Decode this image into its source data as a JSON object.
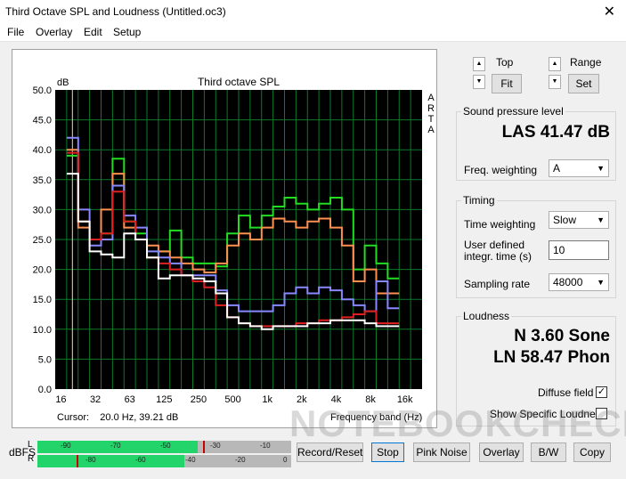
{
  "window": {
    "title": "Third Octave SPL and Loudness (Untitled.oc3)",
    "close_glyph": "✕"
  },
  "menu": [
    "File",
    "Overlay",
    "Edit",
    "Setup"
  ],
  "plot": {
    "title": "Third octave SPL",
    "ylabel": "dB",
    "side_text": [
      "A",
      "R",
      "T",
      "A"
    ],
    "cursor_text": "Cursor:    20.0 Hz, 39.21 dB",
    "xlabel": "Frequency band (Hz)"
  },
  "chart_data": {
    "type": "line",
    "title": "Third octave SPL",
    "ylabel": "dB",
    "xlabel": "Frequency band (Hz)",
    "ylim": [
      0,
      50
    ],
    "yticks": [
      "0.0",
      "5.0",
      "10.0",
      "15.0",
      "20.0",
      "25.0",
      "30.0",
      "35.0",
      "40.0",
      "45.0",
      "50.0"
    ],
    "xticks": [
      "16",
      "32",
      "63",
      "125",
      "250",
      "500",
      "1k",
      "2k",
      "4k",
      "8k",
      "16k"
    ],
    "bands": [
      "16",
      "20",
      "25",
      "31.5",
      "40",
      "50",
      "63",
      "80",
      "100",
      "125",
      "160",
      "200",
      "250",
      "315",
      "400",
      "500",
      "630",
      "800",
      "1k",
      "1.25k",
      "1.6k",
      "2k",
      "2.5k",
      "3.15k",
      "4k",
      "5k",
      "6.3k",
      "8k",
      "10k",
      "12.5k",
      "16k",
      "20k"
    ],
    "grid": true,
    "series": [
      {
        "color": "#22dd22",
        "values": [
          39,
          28,
          25,
          26,
          38.5,
          28,
          26,
          22,
          23,
          26.5,
          22,
          21,
          21,
          20.5,
          26,
          29,
          27,
          29,
          30.5,
          32,
          31,
          30,
          31,
          32,
          30,
          20,
          24,
          21,
          18.5
        ]
      },
      {
        "color": "#ff9050",
        "values": [
          40,
          27,
          25,
          30,
          36,
          27,
          25,
          24,
          23,
          22,
          21,
          20,
          19.5,
          21,
          24,
          26,
          25,
          27,
          28.5,
          28,
          27,
          28,
          28.5,
          27,
          24,
          18,
          20,
          16,
          16
        ]
      },
      {
        "color": "#8888ff",
        "values": [
          42,
          30,
          24,
          25,
          34,
          29,
          27,
          23,
          22,
          21,
          19,
          19,
          19,
          16.5,
          14,
          13,
          13,
          13,
          14,
          16,
          17,
          16,
          17,
          16.5,
          15,
          14,
          13,
          18,
          13.5
        ]
      },
      {
        "color": "#e02020",
        "values": [
          39.5,
          28,
          25,
          26,
          33,
          28,
          25,
          22,
          21,
          20,
          19,
          18,
          17,
          14,
          12,
          11,
          10.5,
          10.5,
          10.5,
          10.5,
          11,
          11,
          11.5,
          11.5,
          12,
          12.5,
          13,
          11,
          11
        ]
      },
      {
        "color": "#ffffff",
        "values": [
          36,
          28,
          23,
          22.5,
          22,
          26,
          25,
          22,
          18.5,
          19,
          19,
          18.5,
          18,
          16,
          12,
          11,
          10.5,
          10,
          10.5,
          10.5,
          10.5,
          11,
          11,
          11.5,
          11.5,
          11.5,
          11,
          10.5,
          10.5
        ]
      }
    ]
  },
  "controls": {
    "top_label": "Top",
    "fit_button": "Fit",
    "range_label": "Range",
    "set_button": "Set",
    "spin_up": "▲",
    "spin_down": "▼"
  },
  "spl": {
    "group_title": "Sound pressure level",
    "value": "LAS 41.47 dB",
    "freq_weighting_label": "Freq. weighting",
    "freq_weighting_value": "A"
  },
  "timing": {
    "group_title": "Timing",
    "time_weighting_label": "Time weighting",
    "time_weighting_value": "Slow",
    "integr_label_1": "User defined",
    "integr_label_2": "integr. time (s)",
    "integr_value": "10",
    "sampling_label": "Sampling rate",
    "sampling_value": "48000"
  },
  "loudness": {
    "group_title": "Loudness",
    "sone": "N 3.60 Sone",
    "phon": "LN 58.47 Phon",
    "diffuse_label": "Diffuse field",
    "diffuse_checked": "✓",
    "specific_label": "Show Specific Loudness"
  },
  "meter": {
    "dbfs_label": "dBFS",
    "left_channel": "L",
    "right_channel": "R",
    "left_ticks": [
      "-90",
      "-70",
      "-50",
      "-30",
      "-10"
    ],
    "right_ticks": [
      "-80",
      "-60",
      "-40",
      "-20",
      "0"
    ],
    "left_level_dbfs": -37,
    "right_level_dbfs": -42
  },
  "buttons": {
    "record_reset": "Record/Reset",
    "stop": "Stop",
    "pink_noise": "Pink Noise",
    "overlay": "Overlay",
    "bw": "B/W",
    "copy": "Copy"
  },
  "watermark": "NOTEBOOKCHECK"
}
